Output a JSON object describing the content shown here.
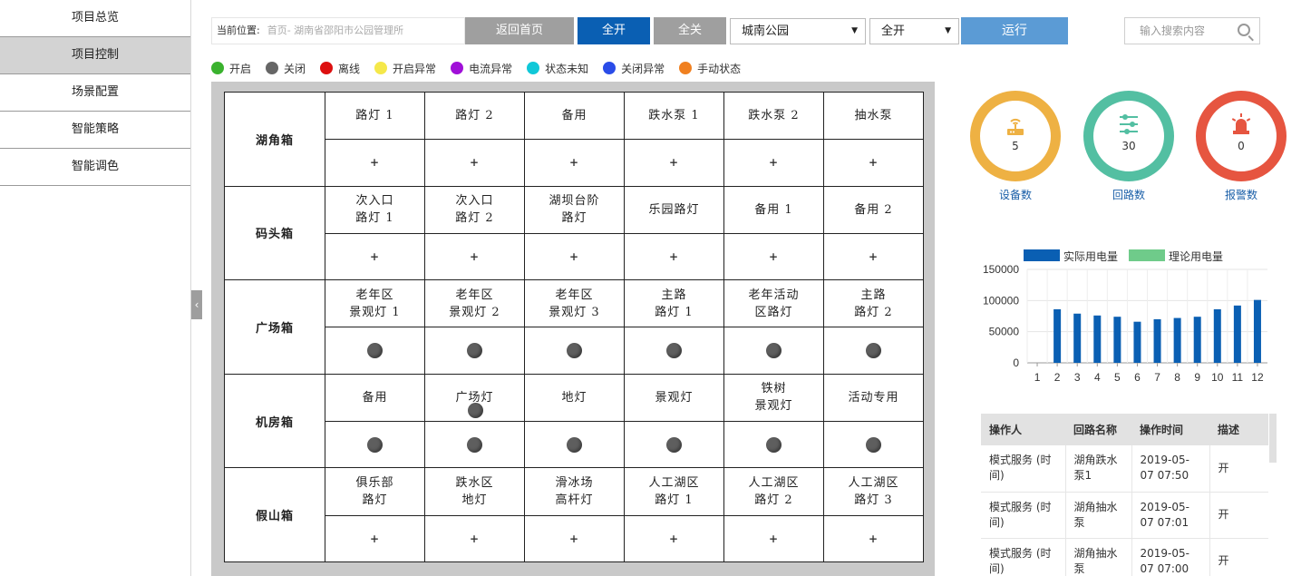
{
  "sidebar": {
    "items": [
      "项目总览",
      "项目控制",
      "场景配置",
      "智能策略",
      "智能调色"
    ],
    "active_index": 1
  },
  "collapse_glyph": "‹",
  "toolbar": {
    "location_label": "当前位置:",
    "location_path": "首页- 湖南省邵阳市公园管理所",
    "home_button": "返回首页",
    "all_on_button": "全开",
    "all_off_button": "全关",
    "park_select": "城南公园",
    "mode_select": "全开",
    "run_button": "运行"
  },
  "search": {
    "placeholder": "输入搜索内容",
    "icon": "search-icon"
  },
  "legend": [
    {
      "label": "开启",
      "color": "#3ab22e"
    },
    {
      "label": "关闭",
      "color": "#666666"
    },
    {
      "label": "离线",
      "color": "#dd1010"
    },
    {
      "label": "开启异常",
      "color": "#f5e84a"
    },
    {
      "label": "电流异常",
      "color": "#a010d8"
    },
    {
      "label": "状态未知",
      "color": "#10c8d8"
    },
    {
      "label": "关闭异常",
      "color": "#2a4ce8"
    },
    {
      "label": "手动状态",
      "color": "#f08020"
    }
  ],
  "boxes": [
    {
      "name": "湖角箱",
      "circuits": [
        {
          "name": [
            "路灯 1"
          ],
          "state": "plus"
        },
        {
          "name": [
            "路灯 2"
          ],
          "state": "plus"
        },
        {
          "name": [
            "备用"
          ],
          "state": "plus"
        },
        {
          "name": [
            "跌水泵 1"
          ],
          "state": "plus"
        },
        {
          "name": [
            "跌水泵 2"
          ],
          "state": "plus"
        },
        {
          "name": [
            "抽水泵"
          ],
          "state": "plus"
        }
      ]
    },
    {
      "name": "码头箱",
      "circuits": [
        {
          "name": [
            "次入口",
            "路灯 1"
          ],
          "state": "plus"
        },
        {
          "name": [
            "次入口",
            "路灯 2"
          ],
          "state": "plus"
        },
        {
          "name": [
            "湖坝台阶",
            "路灯"
          ],
          "state": "plus"
        },
        {
          "name": [
            "乐园路灯"
          ],
          "state": "plus"
        },
        {
          "name": [
            "备用 1"
          ],
          "state": "plus"
        },
        {
          "name": [
            "备用 2"
          ],
          "state": "plus"
        }
      ]
    },
    {
      "name": "广场箱",
      "circuits": [
        {
          "name": [
            "老年区",
            "景观灯 1"
          ],
          "state": "closed"
        },
        {
          "name": [
            "老年区",
            "景观灯 2"
          ],
          "state": "closed"
        },
        {
          "name": [
            "老年区",
            "景观灯 3"
          ],
          "state": "closed"
        },
        {
          "name": [
            "主路",
            "路灯 1"
          ],
          "state": "closed"
        },
        {
          "name": [
            "老年活动",
            "区路灯"
          ],
          "state": "closed"
        },
        {
          "name": [
            "主路",
            "路灯 2"
          ],
          "state": "closed"
        }
      ]
    },
    {
      "name": "机房箱",
      "circuits": [
        {
          "name": [
            "备用"
          ],
          "state": "closed"
        },
        {
          "name": [
            "广场灯"
          ],
          "state": "closed"
        },
        {
          "name": [
            "地灯"
          ],
          "state": "closed"
        },
        {
          "name": [
            "景观灯"
          ],
          "state": "closed"
        },
        {
          "name": [
            "铁树",
            "景观灯"
          ],
          "state": "closed"
        },
        {
          "name": [
            "活动专用"
          ],
          "state": "closed"
        }
      ]
    },
    {
      "name": "假山箱",
      "circuits": [
        {
          "name": [
            "俱乐部",
            "路灯"
          ],
          "state": "plus"
        },
        {
          "name": [
            "跌水区",
            "地灯"
          ],
          "state": "plus"
        },
        {
          "name": [
            "滑冰场",
            "高杆灯"
          ],
          "state": "plus"
        },
        {
          "name": [
            "人工湖区",
            "路灯 1"
          ],
          "state": "plus"
        },
        {
          "name": [
            "人工湖区",
            "路灯 2"
          ],
          "state": "plus"
        },
        {
          "name": [
            "人工湖区",
            "路灯 3"
          ],
          "state": "plus"
        }
      ]
    }
  ],
  "state_symbols": {
    "plus": "+"
  },
  "stats": [
    {
      "label": "设备数",
      "value": "5",
      "color": "#eeb143",
      "icon": "router-icon"
    },
    {
      "label": "回路数",
      "value": "30",
      "color": "#53bfa2",
      "icon": "sliders-icon"
    },
    {
      "label": "报警数",
      "value": "0",
      "color": "#e65540",
      "icon": "alarm-icon"
    }
  ],
  "chart_data": {
    "type": "bar",
    "categories": [
      "1",
      "2",
      "3",
      "4",
      "5",
      "6",
      "7",
      "8",
      "9",
      "10",
      "11",
      "12"
    ],
    "series": [
      {
        "name": "实际用电量",
        "color": "#0a5fb3",
        "values": [
          0,
          86000,
          79000,
          76000,
          74000,
          66000,
          70000,
          72000,
          74000,
          86000,
          92000,
          101000
        ]
      },
      {
        "name": "理论用电量",
        "color": "#6fcb8a",
        "values": [
          0,
          0,
          0,
          0,
          0,
          0,
          0,
          0,
          0,
          0,
          0,
          0
        ]
      }
    ],
    "yticks": [
      "150000",
      "100000",
      "50000",
      "0"
    ],
    "ylim": [
      0,
      150000
    ],
    "legend": "top"
  },
  "log": {
    "headers": [
      "操作人",
      "回路名称",
      "操作时间",
      "描述"
    ],
    "rows": [
      [
        "模式服务 (时间)",
        "湖角跌水泵1",
        "2019-05-07 07:50",
        "开"
      ],
      [
        "模式服务 (时间)",
        "湖角抽水泵",
        "2019-05-07 07:01",
        "开"
      ],
      [
        "模式服务 (时间)",
        "湖角抽水泵",
        "2019-05-07 07:00",
        "开"
      ]
    ]
  }
}
